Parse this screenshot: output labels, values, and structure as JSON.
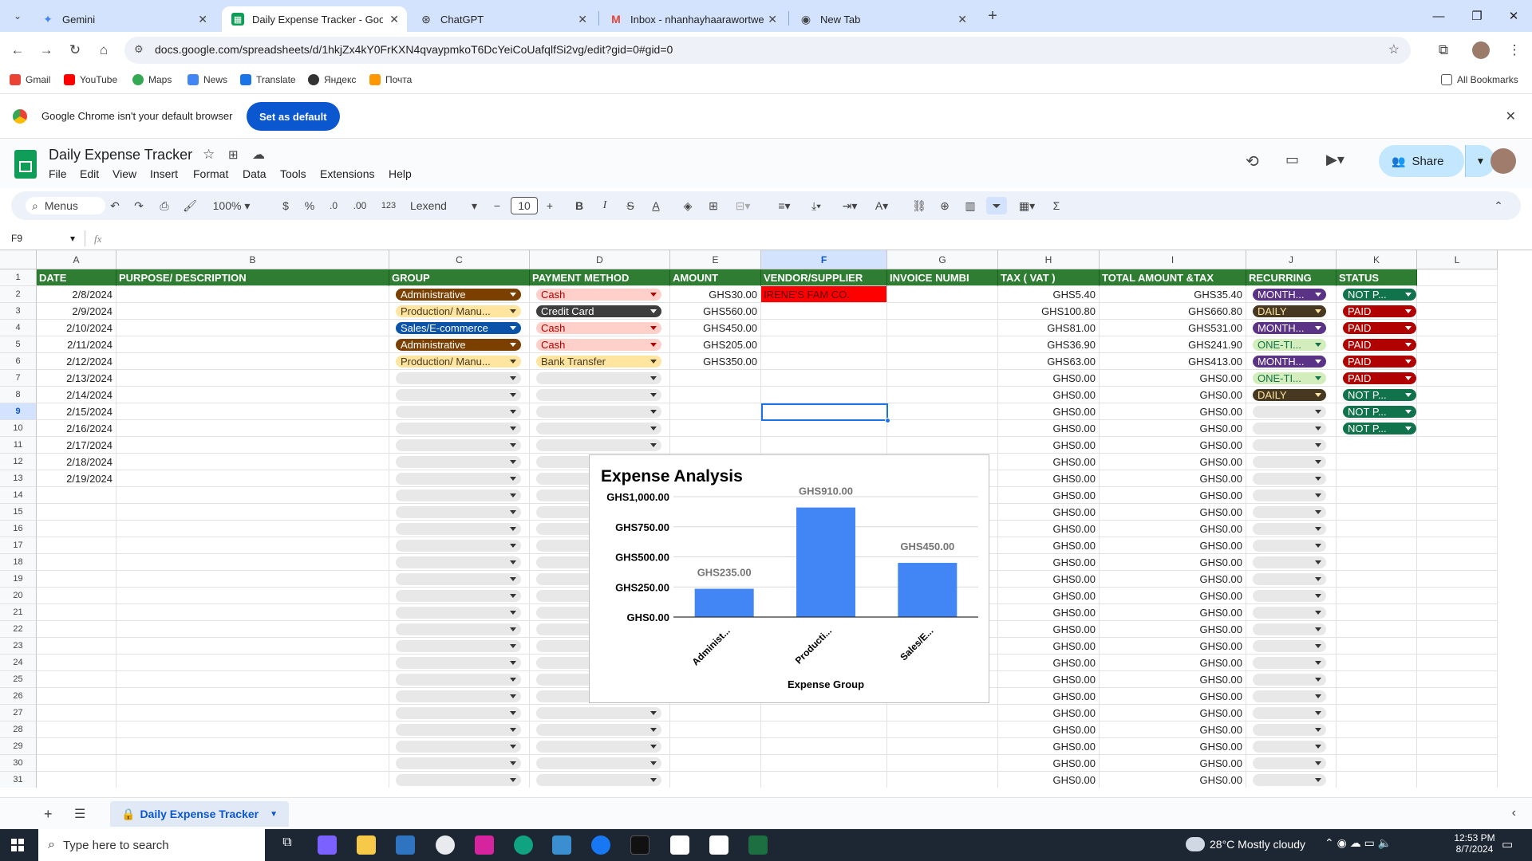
{
  "browser": {
    "tabs": [
      {
        "label": "Gemini"
      },
      {
        "label": "Daily Expense Tracker - Google"
      },
      {
        "label": "ChatGPT"
      },
      {
        "label": "Inbox - nhanhayhaarawortwe@"
      },
      {
        "label": "New Tab"
      }
    ],
    "url": "docs.google.com/spreadsheets/d/1hkjZx4kY0FrKXN4qvaypmkoT6DcYeiCoUafqlfSi2vg/edit?gid=0#gid=0",
    "bookmarks": [
      "Gmail",
      "YouTube",
      "Maps",
      "News",
      "Translate",
      "Яндекс",
      "Почта"
    ],
    "all_bookmarks": "All Bookmarks",
    "infobar_text": "Google Chrome isn't your default browser",
    "set_default_label": "Set as default"
  },
  "sheets": {
    "title": "Daily Expense Tracker",
    "menus": [
      "File",
      "Edit",
      "View",
      "Insert",
      "Format",
      "Data",
      "Tools",
      "Extensions",
      "Help"
    ],
    "share_label": "Share",
    "toolbar": {
      "search": "Menus",
      "zoom": "100%",
      "currency": "$",
      "percent": "%",
      "dec_less": ".0",
      "dec_more": ".00",
      "format": "123",
      "font": "Lexend",
      "font_size": "10"
    },
    "cell_ref": "F9",
    "fx": "fx",
    "sheet_tab": "Daily Expense Tracker"
  },
  "columns": [
    "A",
    "B",
    "C",
    "D",
    "E",
    "F",
    "G",
    "H",
    "I",
    "J",
    "K",
    "L"
  ],
  "headers": [
    "DATE",
    "PURPOSE/ DESCRIPTION",
    "GROUP",
    "PAYMENT METHOD",
    "AMOUNT",
    "VENDOR/SUPPLIER",
    "INVOICE NUMBI",
    "TAX ( VAT )",
    "TOTAL AMOUNT &TAX",
    "RECURRING",
    "STATUS"
  ],
  "rows": [
    {
      "date": "2/8/2024",
      "group": "Administrative",
      "payment": "Cash",
      "amount": "GHS30.00",
      "vendor": "IRENE'S FAM CO.",
      "tax": "GHS5.40",
      "total": "GHS35.40",
      "recurring": "MONTH...",
      "status": "NOT P..."
    },
    {
      "date": "2/9/2024",
      "group": "Production/ Manu...",
      "payment": "Credit Card",
      "amount": "GHS560.00",
      "vendor": "",
      "tax": "GHS100.80",
      "total": "GHS660.80",
      "recurring": "DAILY",
      "status": "PAID"
    },
    {
      "date": "2/10/2024",
      "group": "Sales/E-commerce",
      "payment": "Cash",
      "amount": "GHS450.00",
      "vendor": "",
      "tax": "GHS81.00",
      "total": "GHS531.00",
      "recurring": "MONTH...",
      "status": "PAID"
    },
    {
      "date": "2/11/2024",
      "group": "Administrative",
      "payment": "Cash",
      "amount": "GHS205.00",
      "vendor": "",
      "tax": "GHS36.90",
      "total": "GHS241.90",
      "recurring": "ONE-TI...",
      "status": "PAID"
    },
    {
      "date": "2/12/2024",
      "group": "Production/ Manu...",
      "payment": "Bank Transfer",
      "amount": "GHS350.00",
      "vendor": "",
      "tax": "GHS63.00",
      "total": "GHS413.00",
      "recurring": "MONTH...",
      "status": "PAID"
    },
    {
      "date": "2/13/2024",
      "group": "",
      "payment": "",
      "amount": "",
      "vendor": "",
      "tax": "GHS0.00",
      "total": "GHS0.00",
      "recurring": "ONE-TI...",
      "status": "PAID"
    },
    {
      "date": "2/14/2024",
      "group": "",
      "payment": "",
      "amount": "",
      "vendor": "",
      "tax": "GHS0.00",
      "total": "GHS0.00",
      "recurring": "DAILY",
      "status": "NOT P..."
    },
    {
      "date": "2/15/2024",
      "group": "",
      "payment": "",
      "amount": "",
      "vendor": "",
      "tax": "GHS0.00",
      "total": "GHS0.00",
      "recurring": "",
      "status": "NOT P..."
    },
    {
      "date": "2/16/2024",
      "group": "",
      "payment": "",
      "amount": "",
      "vendor": "",
      "tax": "GHS0.00",
      "total": "GHS0.00",
      "recurring": "",
      "status": "NOT P..."
    },
    {
      "date": "2/17/2024",
      "group": "",
      "payment": "",
      "amount": "",
      "vendor": "",
      "tax": "GHS0.00",
      "total": "GHS0.00",
      "recurring": "",
      "status": ""
    },
    {
      "date": "2/18/2024",
      "group": "",
      "payment": "",
      "amount": "",
      "vendor": "",
      "tax": "GHS0.00",
      "total": "GHS0.00",
      "recurring": "",
      "status": ""
    },
    {
      "date": "2/19/2024",
      "group": "",
      "payment": "",
      "amount": "",
      "vendor": "",
      "tax": "GHS0.00",
      "total": "GHS0.00",
      "recurring": "",
      "status": ""
    }
  ],
  "empty_rows": {
    "from": 14,
    "to": 31,
    "tax": "GHS0.00",
    "total": "GHS0.00"
  },
  "chip_colors": {
    "Administrative": {
      "bg": "#7b3f00",
      "fg": "#ffffff"
    },
    "Production/ Manu...": {
      "bg": "#ffe5a0",
      "fg": "#473821"
    },
    "Sales/E-commerce": {
      "bg": "#0a53a8",
      "fg": "#ffffff"
    },
    "Cash": {
      "bg": "#ffcfc9",
      "fg": "#b10202"
    },
    "Credit Card": {
      "bg": "#3d3d3d",
      "fg": "#ffffff"
    },
    "Bank Transfer": {
      "bg": "#ffe5a0",
      "fg": "#473821"
    },
    "MONTH...": {
      "bg": "#5a3286",
      "fg": "#ffffff"
    },
    "DAILY": {
      "bg": "#473821",
      "fg": "#ffe5a0"
    },
    "ONE-TI...": {
      "bg": "#d4edbc",
      "fg": "#11734b"
    },
    "NOT P...": {
      "bg": "#11734b",
      "fg": "#ffffff"
    },
    "PAID": {
      "bg": "#b10202",
      "fg": "#ffffff"
    }
  },
  "chart_data": {
    "type": "bar",
    "title": "Expense Analysis",
    "xlabel": "Expense Group",
    "ylabel": "",
    "categories": [
      "Administ...",
      "Producti...",
      "Sales/E..."
    ],
    "values": [
      235,
      910,
      450
    ],
    "data_labels": [
      "GHS235.00",
      "GHS910.00",
      "GHS450.00"
    ],
    "yticks": [
      "GHS0.00",
      "GHS250.00",
      "GHS500.00",
      "GHS750.00",
      "GHS1,000.00"
    ],
    "ylim": [
      0,
      1000
    ],
    "bar_color": "#4285f4",
    "grid": true
  },
  "taskbar": {
    "search_placeholder": "Type here to search",
    "weather": "28°C  Mostly cloudy",
    "time": "12:53 PM",
    "date": "8/7/2024"
  },
  "colors": {
    "header_green": "#2e7d32",
    "vendor_red": "#ff0000",
    "accent": "#0b57d0"
  }
}
